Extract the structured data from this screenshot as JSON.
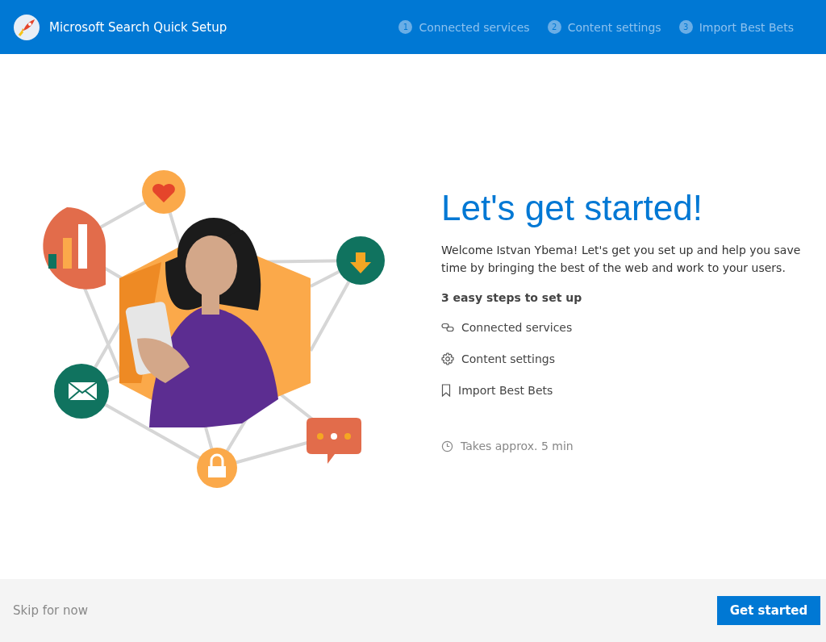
{
  "header": {
    "title": "Microsoft Search Quick Setup",
    "steps": [
      {
        "number": "1",
        "label": "Connected services"
      },
      {
        "number": "2",
        "label": "Content settings"
      },
      {
        "number": "3",
        "label": "Import Best Bets"
      }
    ]
  },
  "intro": {
    "heading": "Let's get started!",
    "message": "Welcome Istvan Ybema! Let's get you set up and help you save time by bringing the best of the web and work to your users.",
    "steps_title": "3 easy steps to set up",
    "steps": [
      {
        "kind": "link",
        "label": "Connected services"
      },
      {
        "kind": "gear",
        "label": "Content settings"
      },
      {
        "kind": "bookmark",
        "label": "Import Best Bets"
      }
    ],
    "duration": "Takes approx. 5 min"
  },
  "footer": {
    "skip": "Skip for now",
    "primary": "Get started"
  }
}
